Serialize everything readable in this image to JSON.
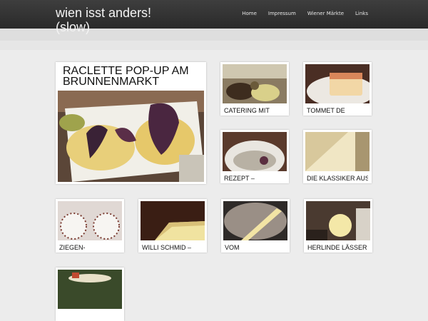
{
  "site": {
    "title": "wien isst anders! (slow)"
  },
  "nav": {
    "items": [
      "Home",
      "Impressum",
      "Wiener Märkte",
      "Links"
    ]
  },
  "featured": {
    "title": "RACLETTE POP-UP AM BRUNNENMARKT",
    "image": "raclette-plate-photo"
  },
  "posts": [
    {
      "title": "CATERING MIT",
      "image": "catering-photo"
    },
    {
      "title": "TOMMET DE",
      "image": "cheese-slice-photo"
    },
    {
      "title": "REZEPT –",
      "image": "bowl-photo"
    },
    {
      "title": "DIE KLASSIKER AUS",
      "image": "cheese-block-photo"
    },
    {
      "title": "ZIEGEN-",
      "image": "goat-cheese-photo"
    },
    {
      "title": "WILLI SCHMID –",
      "image": "cheese-wedge-photo"
    },
    {
      "title": "VOM",
      "image": "cheese-wheel-photo"
    },
    {
      "title": "HERLINDE LÄSSER",
      "image": "melted-cheese-photo"
    },
    {
      "title": "",
      "image": "market-photo"
    }
  ],
  "colors": {
    "header": "#333333",
    "background": "#ececec",
    "card": "#ffffff"
  }
}
